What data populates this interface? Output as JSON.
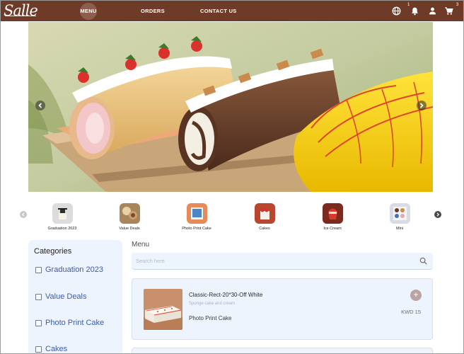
{
  "header": {
    "logo_text": "Salle",
    "nav": {
      "menu": "MENU",
      "orders": "ORDERS",
      "contact": "CONTACT US"
    },
    "notifications_badge": "1",
    "cart_badge": "3",
    "brand_color": "#6e3b28"
  },
  "hero": {
    "slide_count": 7,
    "active_slide": 1
  },
  "categories": [
    {
      "label": "Graduation 2023",
      "icon": "graduation-cake-thumb"
    },
    {
      "label": "Value Deals",
      "icon": "value-deals-thumb"
    },
    {
      "label": "Photo Print Cake",
      "icon": "photo-print-cake-thumb"
    },
    {
      "label": "Cakes",
      "icon": "cake-thumb"
    },
    {
      "label": "Ice Cream",
      "icon": "ice-cream-thumb"
    },
    {
      "label": "Mini",
      "icon": "mini-thumb"
    }
  ],
  "sidebar": {
    "title": "Categories",
    "items": [
      {
        "label": "Graduation 2023"
      },
      {
        "label": "Value Deals"
      },
      {
        "label": "Photo Print Cake"
      },
      {
        "label": "Cakes"
      }
    ]
  },
  "menu": {
    "title": "Menu",
    "search_placeholder": "Search here",
    "products": [
      {
        "name": "Classic-Rect-20*30-Off White",
        "description": "Sponge cake and cream",
        "category": "Photo Print Cake",
        "price": "KWD 15",
        "add_label": "+"
      }
    ]
  }
}
